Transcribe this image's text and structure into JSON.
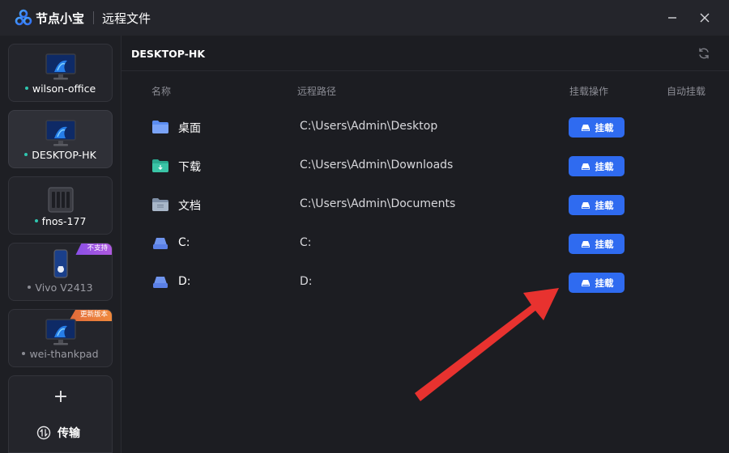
{
  "app": {
    "name": "节点小宝",
    "window_title": "远程文件"
  },
  "sidebar": {
    "devices": [
      {
        "label": "wilson-office",
        "status": "online",
        "type": "pc",
        "badge": ""
      },
      {
        "label": "DESKTOP-HK",
        "status": "online",
        "type": "pc",
        "badge": ""
      },
      {
        "label": "fnos-177",
        "status": "online",
        "type": "nas",
        "badge": ""
      },
      {
        "label": "Vivo V2413",
        "status": "offline",
        "type": "phone",
        "badge": "不支持"
      },
      {
        "label": "wei-thankpad",
        "status": "offline",
        "type": "pc",
        "badge": "更新版本"
      }
    ],
    "add_label": "+",
    "transfer_label": "传输"
  },
  "main": {
    "device_title": "DESKTOP-HK",
    "columns": {
      "name": "名称",
      "path": "远程路径",
      "action": "挂载操作",
      "auto": "自动挂载"
    },
    "rows": [
      {
        "name": "桌面",
        "path": "C:\\Users\\Admin\\Desktop",
        "icon": "folder-desktop-icon",
        "button": "挂载"
      },
      {
        "name": "下载",
        "path": "C:\\Users\\Admin\\Downloads",
        "icon": "folder-download-icon",
        "button": "挂载"
      },
      {
        "name": "文档",
        "path": "C:\\Users\\Admin\\Documents",
        "icon": "folder-document-icon",
        "button": "挂载"
      },
      {
        "name": "C:",
        "path": "C:",
        "icon": "drive-icon",
        "button": "挂载"
      },
      {
        "name": "D:",
        "path": "D:",
        "icon": "drive-icon",
        "button": "挂载"
      }
    ]
  },
  "colors": {
    "accent": "#2f6bf0",
    "online": "#2fc6b0",
    "annotation_arrow": "#e8322f"
  }
}
